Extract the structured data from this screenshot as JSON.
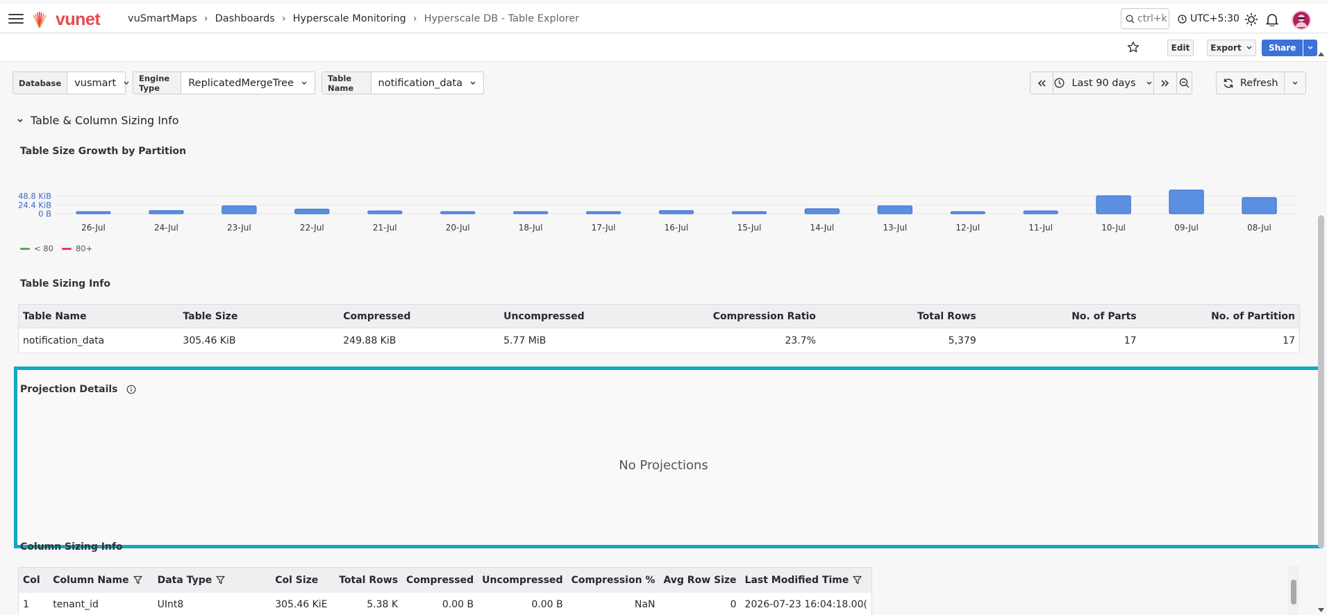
{
  "nav": {
    "logo_text": "vunet",
    "breadcrumbs": [
      "vuSmartMaps",
      "Dashboards",
      "Hyperscale Monitoring"
    ],
    "current_page": "Hyperscale DB - Table Explorer",
    "search_placeholder": "ctrl+k",
    "timezone": "UTC+5:30"
  },
  "toolbar": {
    "edit_label": "Edit",
    "export_label": "Export",
    "share_label": "Share"
  },
  "filters": [
    {
      "label": "Database",
      "value": "vusmart"
    },
    {
      "label": "Engine Type",
      "value": "ReplicatedMergeTree"
    },
    {
      "label": "Table Name",
      "value": "notification_data"
    }
  ],
  "time": {
    "range_label": "Last 90 days",
    "refresh_label": "Refresh"
  },
  "section": {
    "title": "Table & Column Sizing Info"
  },
  "chart_panel": {
    "title": "Table Size Growth by Partition"
  },
  "chart_data": {
    "type": "bar",
    "title": "Table Size Growth by Partition",
    "categories": [
      "26-Jul",
      "24-Jul",
      "23-Jul",
      "22-Jul",
      "21-Jul",
      "20-Jul",
      "18-Jul",
      "17-Jul",
      "16-Jul",
      "15-Jul",
      "14-Jul",
      "13-Jul",
      "12-Jul",
      "11-Jul",
      "10-Jul",
      "09-Jul",
      "08-Jul"
    ],
    "values": [
      6,
      9,
      22,
      13,
      8,
      6,
      6,
      6,
      9,
      6,
      14,
      22,
      6,
      8,
      50,
      66,
      45
    ],
    "unit": "KiB",
    "y_ticks": [
      "0 B",
      "24.4 KiB",
      "48.8 KiB"
    ],
    "ylim": [
      0,
      73.2
    ],
    "bar_color": "#5b8fe0",
    "legend": [
      {
        "label": "< 80",
        "color": "#4caf50"
      },
      {
        "label": "80+",
        "color": "#e53950"
      }
    ]
  },
  "sizing": {
    "title": "Table Sizing Info",
    "columns": [
      "Table Name",
      "Table Size",
      "Compressed",
      "Uncompressed",
      "Compression Ratio",
      "Total Rows",
      "No. of Parts",
      "No. of Partition"
    ],
    "row": [
      "notification_data",
      "305.46 KiB",
      "249.88 KiB",
      "5.77 MiB",
      "23.7%",
      "5,379",
      "17",
      "17"
    ]
  },
  "projection": {
    "title": "Projection Details",
    "empty_text": "No Projections"
  },
  "column_sizing": {
    "title": "Column Sizing Info",
    "columns": [
      "Col",
      "Column Name",
      "Data Type",
      "Col Size",
      "Total Rows",
      "Compressed",
      "Uncompressed",
      "Compression %",
      "Avg Row Size",
      "Last Modified Time"
    ],
    "row": [
      "1",
      "tenant_id",
      "UInt8",
      "305.46 KiE",
      "5.38 K",
      "0.00 B",
      "0.00 B",
      "NaN",
      "0",
      "2026-07-23 16:04:18.00("
    ]
  },
  "colors": {
    "accent": "#3b72d9",
    "highlight_frame": "#13a7c2",
    "brand": "#e8494e"
  }
}
